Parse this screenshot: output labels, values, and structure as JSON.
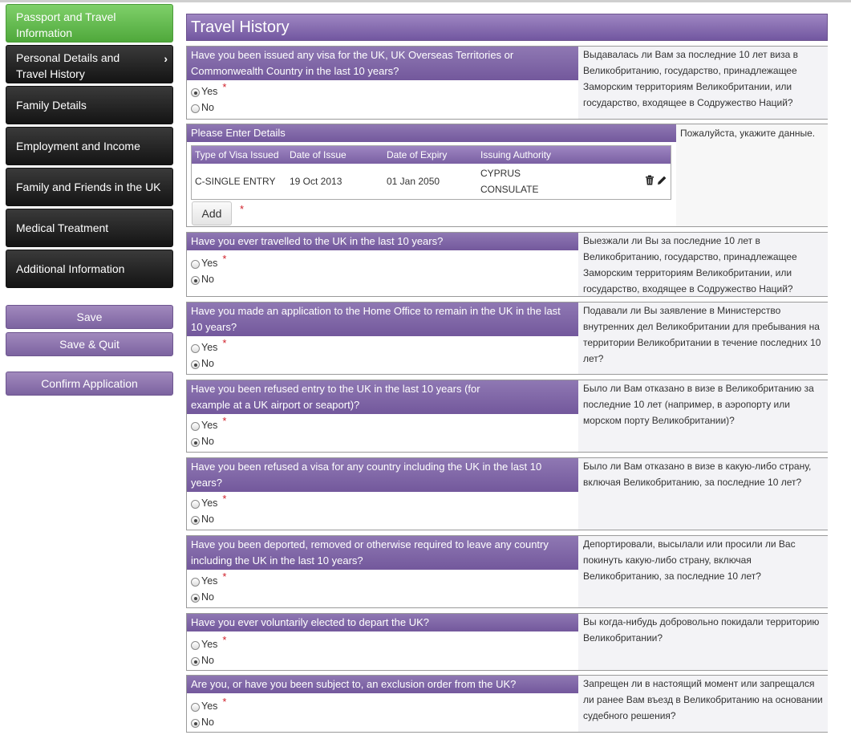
{
  "sidebar": {
    "items": [
      {
        "label": "Passport and Travel Information",
        "active": true
      },
      {
        "label": "Personal Details and Travel History",
        "current": true
      },
      {
        "label": "Family Details"
      },
      {
        "label": "Employment and Income"
      },
      {
        "label": "Family and Friends in the UK"
      },
      {
        "label": "Medical Treatment"
      },
      {
        "label": "Additional Information"
      }
    ],
    "save_label": "Save",
    "save_quit_label": "Save & Quit",
    "confirm_label": "Confirm Application"
  },
  "page_title": "Travel History",
  "details": {
    "heading": "Please Enter Details",
    "translation": "Пожалуйста, укажите данные.",
    "columns": [
      "Type of Visa Issued",
      "Date of Issue",
      "Date of Expiry",
      "Issuing Authority"
    ],
    "rows": [
      {
        "type": "C-SINGLE ENTRY",
        "issue": "19 Oct 2013",
        "expiry": "01 Jan 2050",
        "authority": "CYPRUS CONSULATE"
      }
    ],
    "add_label": "Add",
    "required_mark": "*"
  },
  "radio_labels": {
    "yes": "Yes",
    "no": "No",
    "required_mark": "*"
  },
  "questions": [
    {
      "question": "Have you been issued any visa for the UK, UK Overseas Territories or Commonwealth Country in the last 10 years?",
      "translation": "Выдавалась ли Вам за последние 10 лет виза в Великобританию, государство, принадлежащее Заморским территориям Великобритании, или государство, входящее в Содружество Наций?",
      "answer": "Yes"
    },
    {
      "question": "Have you ever travelled to the UK in the last 10 years?",
      "translation": "Выезжали ли Вы за последние 10 лет в Великобританию, государство, принадлежащее Заморским территориям Великобритании, или государство, входящее в Содружество Наций?",
      "answer": "No"
    },
    {
      "question": "Have you made an application to the Home Office to remain in the UK in the last 10 years?",
      "translation": "Подавали ли Вы заявление в Министерство внутренних дел Великобритании для пребывания на территории Великобритании в течение последних 10 лет?",
      "answer": "No"
    },
    {
      "question": "Have you been refused entry to the UK in the last 10 years (for example at a UK airport or seaport)?",
      "translation": "Было ли Вам отказано в визе в Великобританию за последние 10 лет (например, в аэропорту или морском порту Великобритании)?",
      "answer": "No"
    },
    {
      "question": "Have you been refused a visa for any country including the UK in the last 10 years?",
      "translation": "Было ли Вам отказано в визе в какую-либо страну, включая Великобританию, за последние 10 лет?",
      "answer": "No"
    },
    {
      "question": "Have you been deported, removed or otherwise required to leave any country including the UK in the last 10 years?",
      "translation": "Депортировали, высылали или просили ли Вас покинуть какую-либо страну, включая Великобританию, за последние 10 лет?",
      "answer": "No"
    },
    {
      "question": "Have you ever voluntarily elected to depart the UK?",
      "translation": "Вы когда-нибудь добровольно покидали территорию Великобритании?",
      "answer": "No"
    },
    {
      "question": "Are you, or have you been subject to, an exclusion order from the UK?",
      "translation": "Запрещен ли в настоящий момент или запрещался ли ранее Вам въезд в Великобританию на основании судебного решения?",
      "answer": "No"
    }
  ]
}
